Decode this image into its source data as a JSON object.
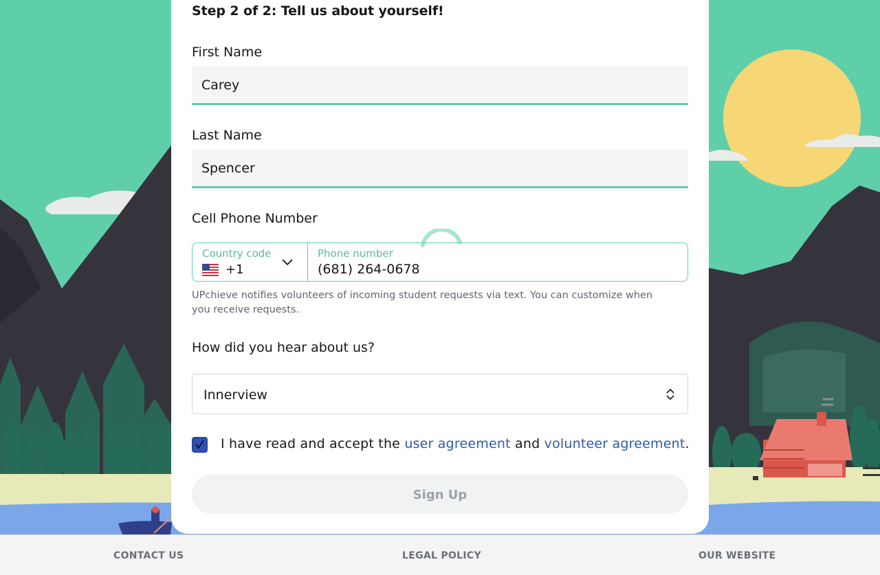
{
  "form": {
    "step_title": "Step 2 of 2: Tell us about yourself!",
    "first_name": {
      "label": "First Name",
      "value": "Carey"
    },
    "last_name": {
      "label": "Last Name",
      "value": "Spencer"
    },
    "phone": {
      "label": "Cell Phone Number",
      "country_label": "Country code",
      "country_value": "+1",
      "number_label": "Phone number",
      "number_value": "(681) 264-0678",
      "helper": "UPchieve notifies volunteers of incoming student requests via text. You can customize when you receive requests."
    },
    "referral": {
      "label": "How did you hear about us?",
      "value": "Innerview"
    },
    "agreement": {
      "checked": true,
      "prefix": "I have read and accept the",
      "link1": "user agreement",
      "middle": "and",
      "link2": "volunteer agreement",
      "suffix": "."
    },
    "submit_label": "Sign Up"
  },
  "footer": {
    "contact": "CONTACT US",
    "legal": "LEGAL POLICY",
    "website": "OUR WEBSITE"
  },
  "colors": {
    "accent": "#5fcfaa",
    "link": "#2e5aa8",
    "checkbox": "#2f4fb8",
    "sky": "#5fcfaa",
    "sun": "#f7d775"
  },
  "icons": [
    "us-flag-icon",
    "chevron-down-icon",
    "select-arrows-icon",
    "checkmark-icon",
    "loading-spinner-icon"
  ]
}
